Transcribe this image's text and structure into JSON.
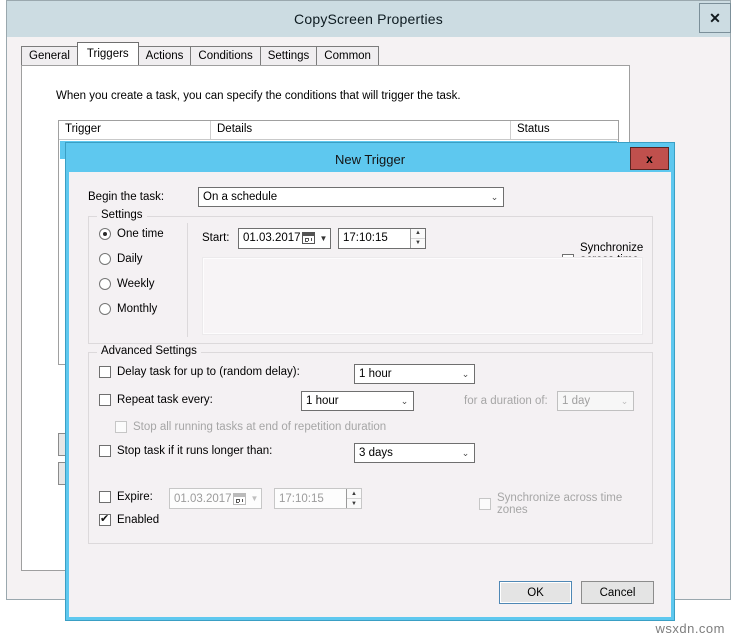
{
  "parent_window": {
    "title": "CopyScreen Properties",
    "close_label": "✕",
    "tabs": [
      {
        "label": "General",
        "active": false
      },
      {
        "label": "Triggers",
        "active": true
      },
      {
        "label": "Actions",
        "active": false
      },
      {
        "label": "Conditions",
        "active": false
      },
      {
        "label": "Settings",
        "active": false
      },
      {
        "label": "Common",
        "active": false
      }
    ],
    "description": "When you create a task, you can specify the conditions that will trigger the task.",
    "grid_columns": [
      "Trigger",
      "Details",
      "Status"
    ]
  },
  "dialog": {
    "title": "New Trigger",
    "close_label": "x",
    "begin_task": {
      "label": "Begin the task:",
      "value": "On a schedule"
    },
    "settings": {
      "legend": "Settings",
      "radios": [
        {
          "label": "One time",
          "selected": true
        },
        {
          "label": "Daily",
          "selected": false
        },
        {
          "label": "Weekly",
          "selected": false
        },
        {
          "label": "Monthly",
          "selected": false
        }
      ],
      "start_label": "Start:",
      "start_date": "01.03.2017",
      "start_time": "17:10:15",
      "sync_label": "Synchronize across time zones",
      "sync_checked": false
    },
    "advanced": {
      "legend": "Advanced Settings",
      "delay_label": "Delay task for up to (random delay):",
      "delay_checked": false,
      "delay_value": "1 hour",
      "repeat_label": "Repeat task every:",
      "repeat_checked": false,
      "repeat_value": "1 hour",
      "duration_label": "for a duration of:",
      "duration_value": "1 day",
      "stop_all_label": "Stop all running tasks at end of repetition duration",
      "stop_all_checked": false,
      "stop_task_label": "Stop task if it runs longer than:",
      "stop_task_checked": false,
      "stop_task_value": "3 days",
      "expire_label": "Expire:",
      "expire_checked": false,
      "expire_date": "01.03.2017",
      "expire_time": "17:10:15",
      "expire_sync_label": "Synchronize across time zones",
      "expire_sync_checked": false,
      "enabled_label": "Enabled",
      "enabled_checked": true
    },
    "buttons": {
      "ok": "OK",
      "cancel": "Cancel"
    }
  },
  "watermark": "wsxdn.com",
  "colors": {
    "dialog_accent": "#5ec8ef",
    "parent_titlebar": "#ccdce2",
    "close_red": "#c0504d",
    "selection": "#5ec8ef"
  },
  "spinner": {
    "up": "▲",
    "down": "▼"
  },
  "combo_arrow": "⌄",
  "date_arrow": "▼"
}
